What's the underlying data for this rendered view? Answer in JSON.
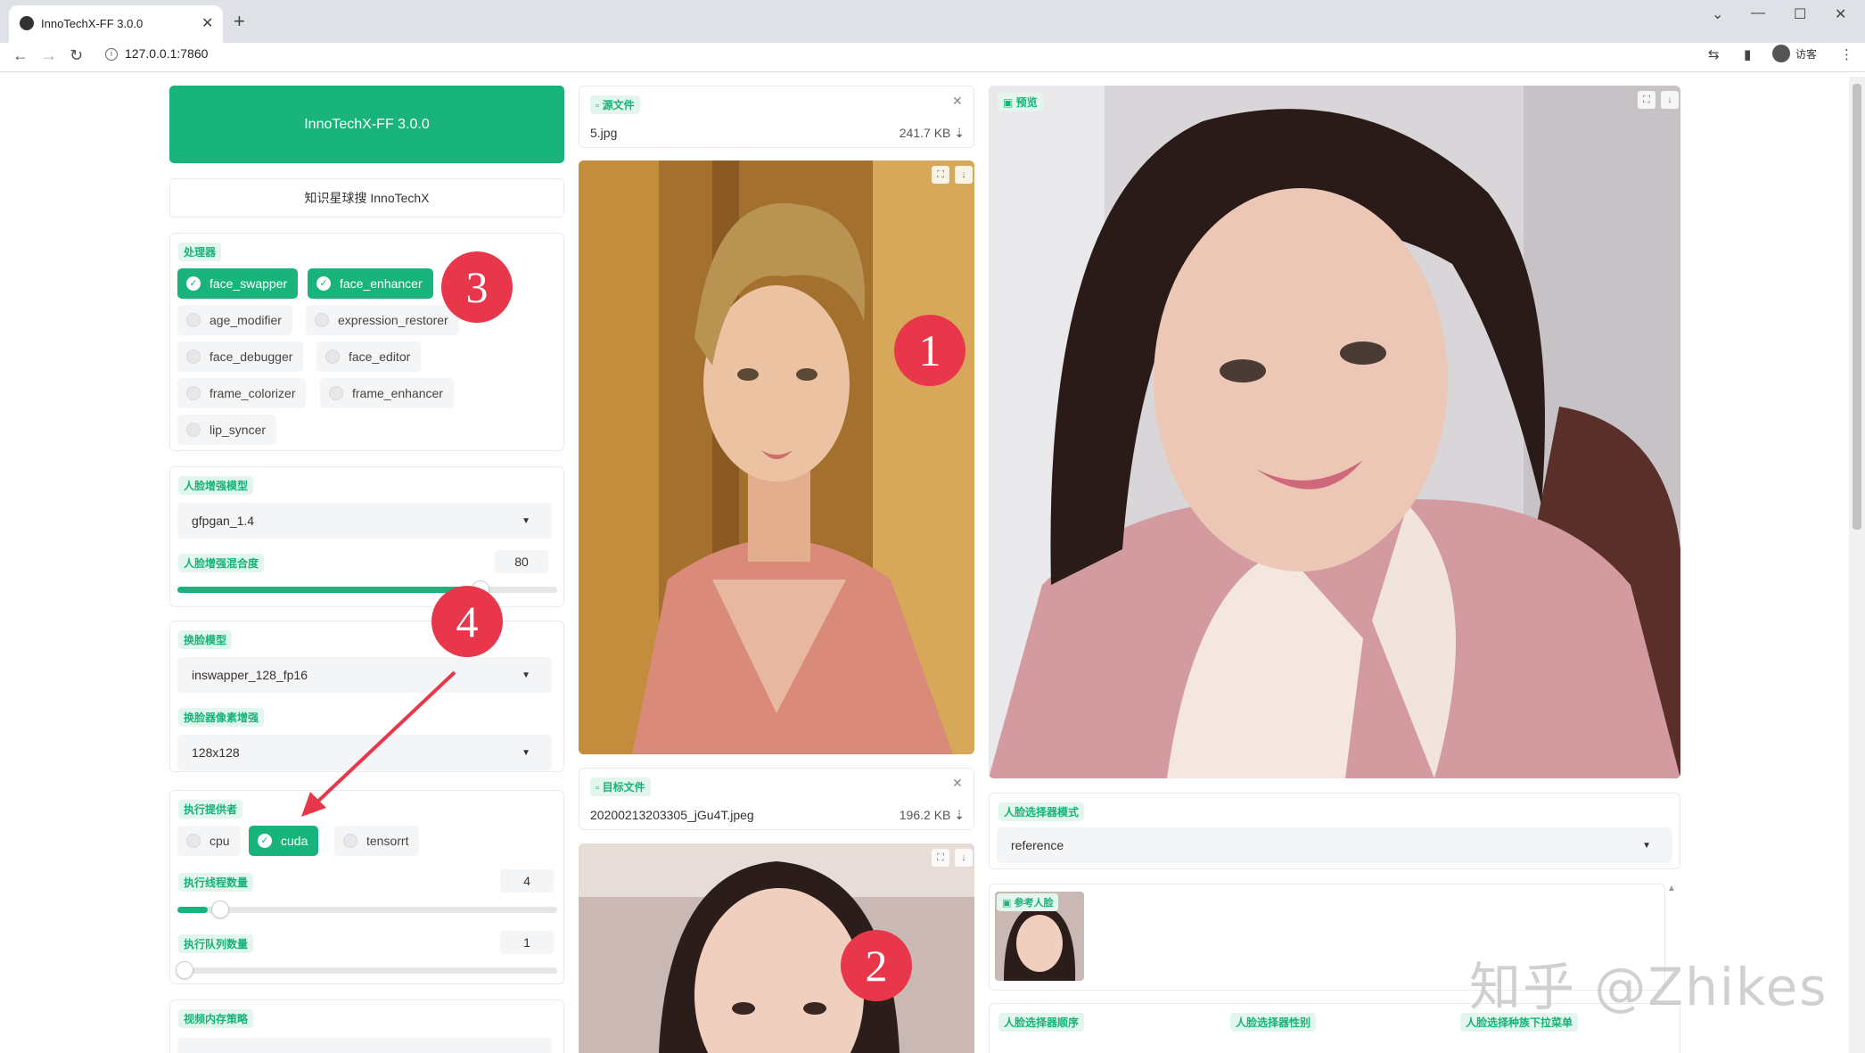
{
  "browser": {
    "tab_title": "InnoTechX-FF 3.0.0",
    "url": "127.0.0.1:7860",
    "profile_label": "访客"
  },
  "app": {
    "title_button": "InnoTechX-FF 3.0.0",
    "subtitle_button": "知识星球搜 InnoTechX",
    "processors": {
      "label": "处理器",
      "items": [
        {
          "name": "face_swapper",
          "checked": true
        },
        {
          "name": "face_enhancer",
          "checked": true
        },
        {
          "name": "age_modifier",
          "checked": false
        },
        {
          "name": "expression_restorer",
          "checked": false
        },
        {
          "name": "face_debugger",
          "checked": false
        },
        {
          "name": "face_editor",
          "checked": false
        },
        {
          "name": "frame_colorizer",
          "checked": false
        },
        {
          "name": "frame_enhancer",
          "checked": false
        },
        {
          "name": "lip_syncer",
          "checked": false
        }
      ]
    },
    "face_enhancer": {
      "model_label": "人脸增强模型",
      "model_value": "gfpgan_1.4",
      "blend_label": "人脸增强混合度",
      "blend_value": "80",
      "blend_fraction": 0.8
    },
    "face_swapper": {
      "model_label": "换脸模型",
      "model_value": "inswapper_128_fp16",
      "pixel_boost_label": "换脸器像素增强",
      "pixel_boost_value": "128x128"
    },
    "execution": {
      "providers_label": "执行提供者",
      "providers": [
        {
          "name": "cpu",
          "checked": false
        },
        {
          "name": "cuda",
          "checked": true
        },
        {
          "name": "tensorrt",
          "checked": false
        }
      ],
      "thread_label": "执行线程数量",
      "thread_value": "4",
      "thread_fraction": 0.08,
      "queue_label": "执行队列数量",
      "queue_value": "1",
      "queue_fraction": 0.0
    },
    "video_memory_label": "视频内存策略",
    "source": {
      "label": "源文件",
      "filename": "5.jpg",
      "size": "241.7 KB ⇣"
    },
    "target": {
      "label": "目标文件",
      "filename": "20200213203305_jGu4T.jpeg",
      "size": "196.2 KB ⇣"
    },
    "preview_label": "预览",
    "face_selector": {
      "mode_label": "人脸选择器模式",
      "mode_value": "reference",
      "reference_label": "参考人脸",
      "order_label": "人脸选择器顺序",
      "gender_label": "人脸选择器性别",
      "race_label": "人脸选择种族下拉菜单"
    }
  },
  "annotations": [
    "1",
    "2",
    "3",
    "4"
  ],
  "watermark": "知乎 @Zhikes",
  "colors": {
    "accent": "#18b47c",
    "badge": "#e8374a",
    "label_bg": "#e3f6ee"
  }
}
